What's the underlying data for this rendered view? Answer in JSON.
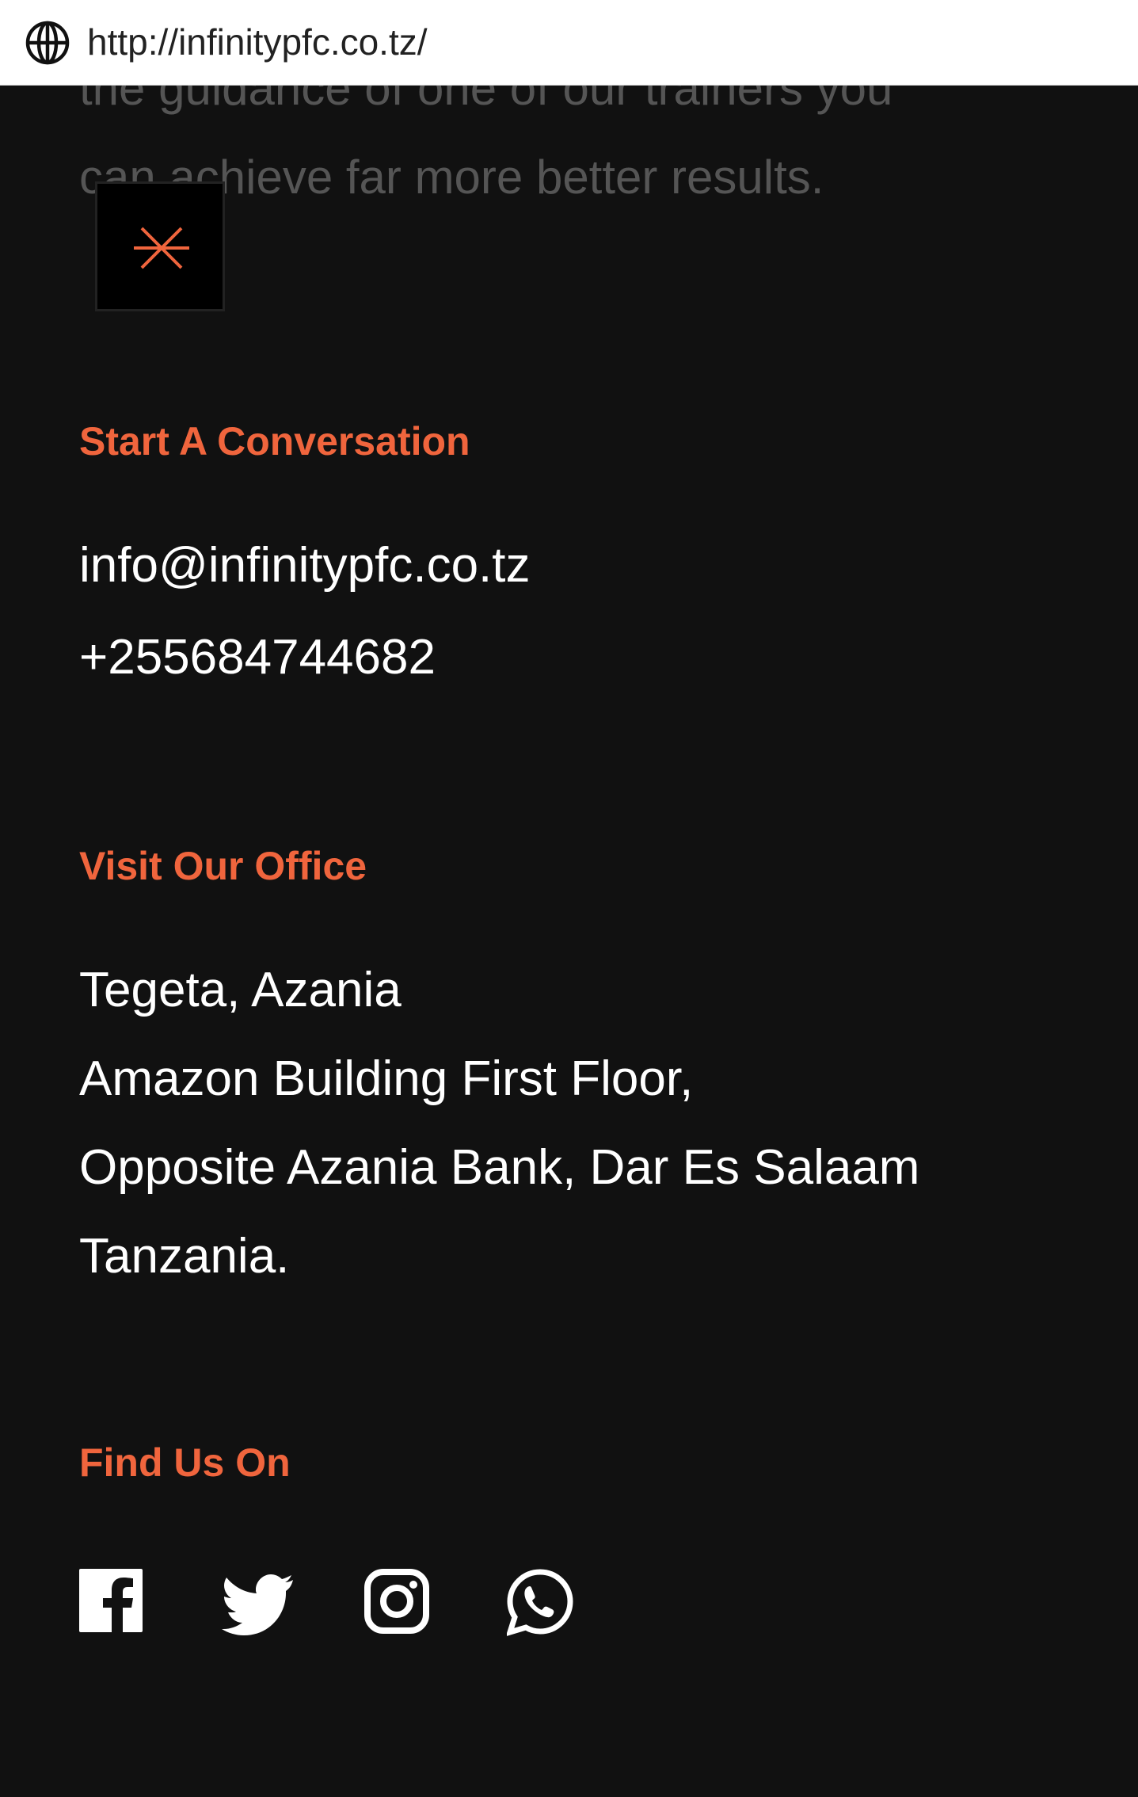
{
  "browser": {
    "url": "http://infinitypfc.co.tz/",
    "globe_icon": "globe-icon"
  },
  "intro": {
    "line1": "the guidance of one of our trainers you",
    "line2": "can achieve far more better results."
  },
  "menu": {
    "close_icon": "close-asterisk-icon",
    "accent": "#f0653d"
  },
  "contact": {
    "title": "Start A Conversation",
    "email": "info@infinitypfc.co.tz",
    "phone": "+255684744682"
  },
  "office": {
    "title": "Visit Our Office",
    "address_lines": [
      "Tegeta, Azania",
      "Amazon Building First Floor,",
      "Opposite Azania Bank, Dar Es Salaam",
      "Tanzania."
    ]
  },
  "social": {
    "title": "Find Us On",
    "icons": [
      "facebook-icon",
      "twitter-icon",
      "instagram-icon",
      "whatsapp-icon"
    ]
  },
  "colors": {
    "background": "#111111",
    "accent": "#f0653d",
    "text": "#ffffff",
    "muted": "#555555"
  }
}
